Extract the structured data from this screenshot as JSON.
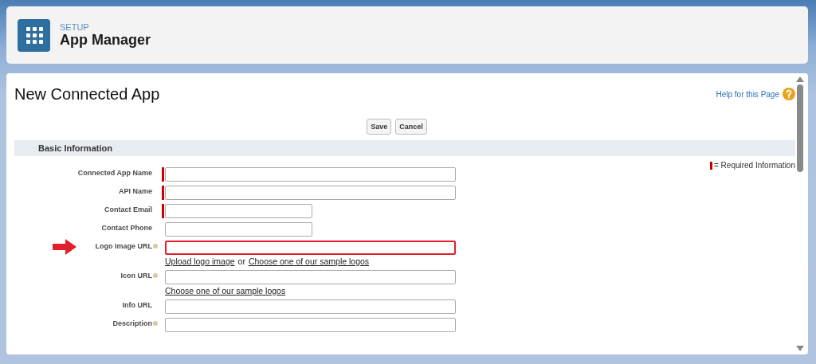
{
  "header": {
    "eyebrow": "SETUP",
    "title": "App Manager"
  },
  "page": {
    "title": "New Connected App",
    "help_link": "Help for this Page"
  },
  "buttons": [
    "Save",
    "Cancel"
  ],
  "section": {
    "title": "Basic Information",
    "legend": "= Required Information"
  },
  "fields": [
    {
      "label": "Connected App Name",
      "kind": "long",
      "required": true,
      "help": false,
      "highlighted": false
    },
    {
      "label": "API Name",
      "kind": "long",
      "required": true,
      "help": false,
      "highlighted": false
    },
    {
      "label": "Contact Email",
      "kind": "short",
      "required": true,
      "help": false,
      "highlighted": false
    },
    {
      "label": "Contact Phone",
      "kind": "short",
      "required": false,
      "help": false,
      "highlighted": false
    },
    {
      "label": "Logo Image URL",
      "kind": "long",
      "required": false,
      "help": true,
      "highlighted": true,
      "links": [
        {
          "kind": "link",
          "text": "Upload logo image"
        },
        {
          "kind": "text",
          "text": "or"
        },
        {
          "kind": "link",
          "text": "Choose one of our sample logos"
        }
      ]
    },
    {
      "label": "Icon URL",
      "kind": "long",
      "required": false,
      "help": true,
      "highlighted": false,
      "links": [
        {
          "kind": "link",
          "text": "Choose one of our sample logos"
        }
      ]
    },
    {
      "label": "Info URL",
      "kind": "long",
      "required": false,
      "help": false,
      "highlighted": false
    },
    {
      "label": "Description",
      "kind": "long",
      "required": false,
      "help": true,
      "highlighted": false
    }
  ]
}
